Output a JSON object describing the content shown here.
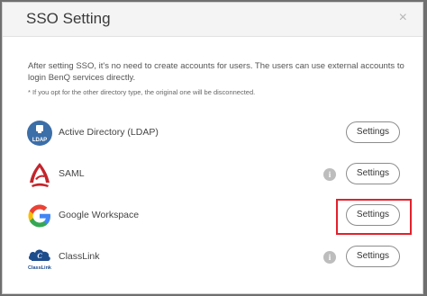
{
  "dialog": {
    "title": "SSO Setting",
    "close_glyph": "×",
    "description": "After setting SSO, it's no need to create accounts for users. The users can use external accounts to login BenQ services directly.",
    "note": "* If you opt for the other directory type, the original one will be disconnected."
  },
  "providers": [
    {
      "name": "Active Directory (LDAP)",
      "logo_text": "LDAP",
      "button": "Settings",
      "has_info": false
    },
    {
      "name": "SAML",
      "button": "Settings",
      "has_info": true
    },
    {
      "name": "Google Workspace",
      "button": "Settings",
      "has_info": false,
      "highlighted": true
    },
    {
      "name": "ClassLink",
      "logo_text": "ClassLink",
      "button": "Settings",
      "has_info": true
    }
  ],
  "info_glyph": "i",
  "colors": {
    "highlight": "#e3202b",
    "ldap_blue": "#3c6ea8",
    "saml_red": "#c4242b",
    "classlink_blue": "#1e4d8c"
  }
}
